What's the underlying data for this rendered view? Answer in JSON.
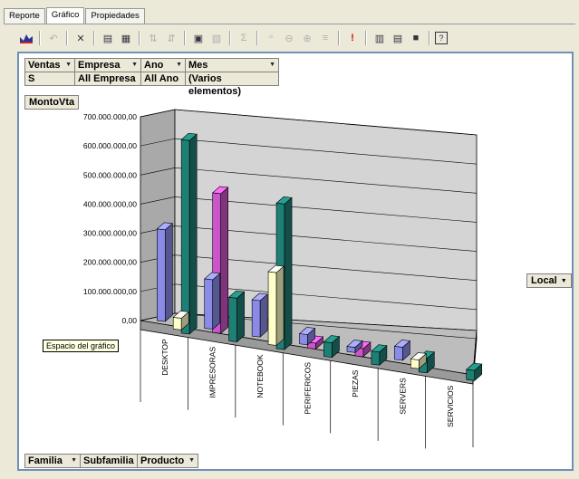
{
  "tabs": [
    {
      "label": "Reporte",
      "active": false
    },
    {
      "label": "Gráfico",
      "active": true
    },
    {
      "label": "Propiedades",
      "active": false
    }
  ],
  "toolbar_icons": [
    "chart-wizard-icon",
    "undo-icon",
    "delete-icon",
    "field-list-icon",
    "chart-type-icon",
    "sort-ascending-icon",
    "sort-descending-icon",
    "filter-icon",
    "expand-icon",
    "autosum-icon",
    "show-top-icon",
    "hide-details-icon",
    "show-details-icon",
    "refresh-icon",
    "export-icon",
    "properties-icon",
    "help-icon"
  ],
  "filters": [
    {
      "label": "Ventas",
      "value": "S"
    },
    {
      "label": "Empresa",
      "value": "All Empresa"
    },
    {
      "label": "Ano",
      "value": "All Ano"
    },
    {
      "label": "Mes",
      "value": "(Varios elementos)"
    }
  ],
  "measure_label": "MontoVta",
  "series_field": "Local",
  "tooltip": "Espacio del gráfico",
  "bottom_fields": [
    "Familia",
    "Subfamilia",
    "Producto"
  ],
  "chart_data": {
    "type": "bar",
    "y_axis_ticks": [
      "0,00",
      "100.000.000,00",
      "200.000.000,00",
      "300.000.000,00",
      "400.000.000,00",
      "500.000.000,00",
      "600.000.000,00",
      "700.000.000,00"
    ],
    "ylim": [
      0,
      700000000
    ],
    "categories": [
      "DESKTOP",
      "IMPRESORAS",
      "NOTEBOOK",
      "PERIFERICOS",
      "PIEZAS",
      "SERVERS",
      "SERVICIOS"
    ],
    "colors": [
      "#8a8ae8",
      "#cc55cc",
      "#ffffc8",
      "#1e7f74"
    ],
    "series": [
      {
        "values": [
          315000000,
          170000000,
          125000000,
          35000000,
          18000000,
          45000000,
          0
        ]
      },
      {
        "values": [
          0,
          480000000,
          0,
          20000000,
          28000000,
          0,
          0
        ]
      },
      {
        "values": [
          40000000,
          0,
          250000000,
          0,
          0,
          30000000,
          0
        ]
      },
      {
        "values": [
          665000000,
          150000000,
          500000000,
          50000000,
          45000000,
          50000000,
          35000000
        ]
      }
    ]
  }
}
